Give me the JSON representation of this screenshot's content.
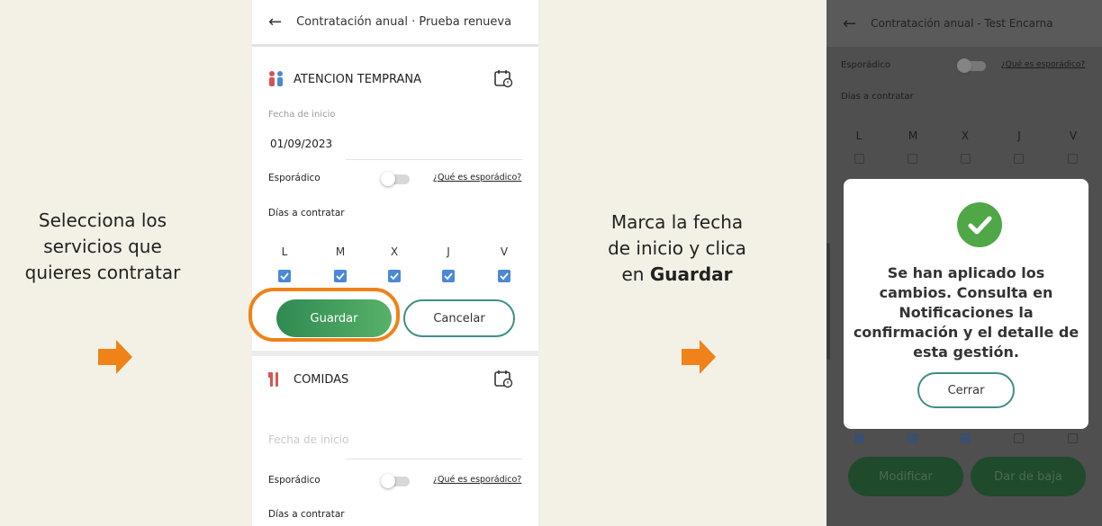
{
  "left_instruction": {
    "line1": "Selecciona los",
    "line2": "servicios que",
    "line3": "quieres contratar"
  },
  "mid_instruction": {
    "line1": "Marca la fecha",
    "line2": "de inicio y clica",
    "line3_prefix": "en",
    "line3_bold": "Guardar"
  },
  "accent": "#ef8219",
  "phone1": {
    "title": "Contratación anual · Prueba renueva",
    "service1": {
      "name": "ATENCION TEMPRANA",
      "icon": "people-icon",
      "date_label": "Fecha de inicio",
      "date_value": "01/09/2023",
      "sporadic_label": "Esporádico",
      "sporadic_link": "¿Qué es esporádico?",
      "days_label": "Días a contratar",
      "days": [
        "L",
        "M",
        "X",
        "J",
        "V"
      ],
      "save_label": "Guardar",
      "cancel_label": "Cancelar"
    },
    "service2": {
      "name": "COMIDAS",
      "icon": "cutlery-icon",
      "date_label": "Fecha de inicio",
      "sporadic_label": "Esporádico",
      "sporadic_link": "¿Qué es esporádico?",
      "days_label": "Días a contratar"
    }
  },
  "phone2": {
    "title": "Contratación anual - Test Encarna",
    "sporadic_label": "Esporádico",
    "sporadic_link": "¿Qué es esporádico?",
    "days_label": "Días a contratar",
    "days": [
      "L",
      "M",
      "X",
      "J",
      "V"
    ],
    "modal": {
      "line1": "Se han aplicado los",
      "line2": "cambios. Consulta en",
      "line3": "Notificaciones la",
      "line4": "confirmación y el detalle de",
      "line5": "esta gestión.",
      "close_label": "Cerrar"
    },
    "modify_label": "Modificar",
    "cancel_sub_label": "Dar de baja"
  }
}
